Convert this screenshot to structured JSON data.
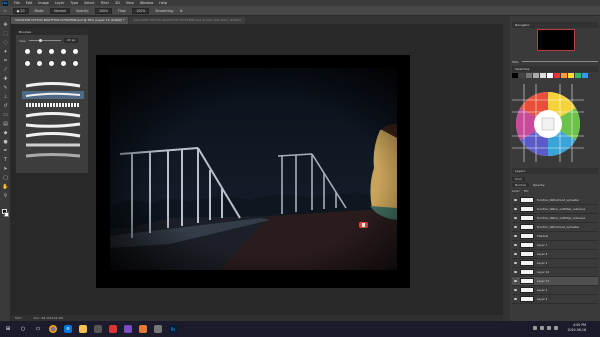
{
  "menubar": {
    "app_logo": "Ps",
    "items": [
      "File",
      "Edit",
      "Image",
      "Layer",
      "Type",
      "Select",
      "Filter",
      "3D",
      "View",
      "Window",
      "Help"
    ]
  },
  "options_bar": {
    "mode_label": "Mode:",
    "mode_value": "Normal",
    "opacity_label": "Opacity:",
    "opacity_value": "100%",
    "flow_label": "Flow:",
    "flow_value": "100%",
    "smoothing_label": "Smoothing:"
  },
  "tabs": [
    {
      "label": "VACATION TATTOO NIGHTTOP CUTSCENE.psd @ 50% (Layer 11, RGB/8) *",
      "active": true
    },
    {
      "label": "VACATION TATTOO NIGHTTOP CUTSCENE.psd @ 50% (the story, RGB/8)",
      "active": false
    }
  ],
  "brush_panel": {
    "title": "Brushes",
    "size_label": "Size:",
    "size_value": "20 px"
  },
  "right_panels": {
    "navigator_title": "Navigator",
    "zoom_value": "50%",
    "swatches_title": "Swatches",
    "layers_title": "Layers",
    "kind_label": "Kind",
    "blend_mode": "Normal",
    "opacity_label": "Opacity:",
    "lock_label": "Lock:",
    "fill_label": "Fill:"
  },
  "layers": [
    {
      "name": "fonction_fatherhood_sylvester"
    },
    {
      "name": "fonction_father_outfiltop_cutscene"
    },
    {
      "name": "fonction_father_outfiltop_cutscene"
    },
    {
      "name": "fonction_fatherhood_sylvester"
    },
    {
      "name": "Shadow"
    },
    {
      "name": "Layer 7"
    },
    {
      "name": "Layer 8"
    },
    {
      "name": "Layer 9"
    },
    {
      "name": "Layer 10"
    },
    {
      "name": "Layer 11",
      "selected": true
    },
    {
      "name": "Layer 1"
    },
    {
      "name": "Layer 2"
    }
  ],
  "status_bar": {
    "zoom": "50%",
    "doc": "Doc: 28.1M/144.4M"
  },
  "taskbar": {
    "time": "4:00 PM",
    "date": "2019-06-16"
  },
  "colors": {
    "workspace": "#282828",
    "panel": "#3a3a3a",
    "accent_selection": "#4f6a87"
  }
}
